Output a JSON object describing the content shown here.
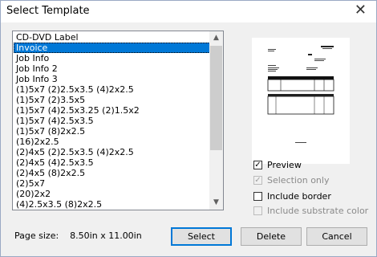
{
  "window": {
    "title": "Select Template",
    "close_glyph": "✕"
  },
  "list": {
    "items": [
      "CD-DVD Label",
      "Invoice",
      "Job Info",
      "Job Info 2",
      "Job Info 3",
      "(1)5x7 (2)2.5x3.5 (4)2x2.5",
      "(1)5x7 (2)3.5x5",
      "(1)5x7 (4)2.5x3.25 (2)1.5x2",
      "(1)5x7 (4)2.5x3.5",
      "(1)5x7 (8)2x2.5",
      "(16)2x2.5",
      "(2)4x5 (2)2.5x3.5 (4)2x2.5",
      "(2)4x5 (4)2.5x3.5",
      "(2)4x5 (8)2x2.5",
      "(2)5x7",
      "(20)2x2",
      "(4)2.5x3.5 (8)2x2.5"
    ],
    "selected_index": 1
  },
  "options": {
    "preview": {
      "label": "Preview",
      "checked": true,
      "enabled": true
    },
    "selection_only": {
      "label": "Selection only",
      "checked": true,
      "enabled": false
    },
    "include_border": {
      "label": "Include border",
      "checked": false,
      "enabled": true
    },
    "include_substrate_color": {
      "label": "Include substrate color",
      "checked": false,
      "enabled": false
    }
  },
  "page_size": {
    "label": "Page size:",
    "value": "8.50in x 11.00in"
  },
  "buttons": {
    "select": "Select",
    "delete": "Delete",
    "cancel": "Cancel"
  },
  "icons": {
    "check": "✓",
    "scroll_up": "▲",
    "scroll_down": "▼"
  }
}
